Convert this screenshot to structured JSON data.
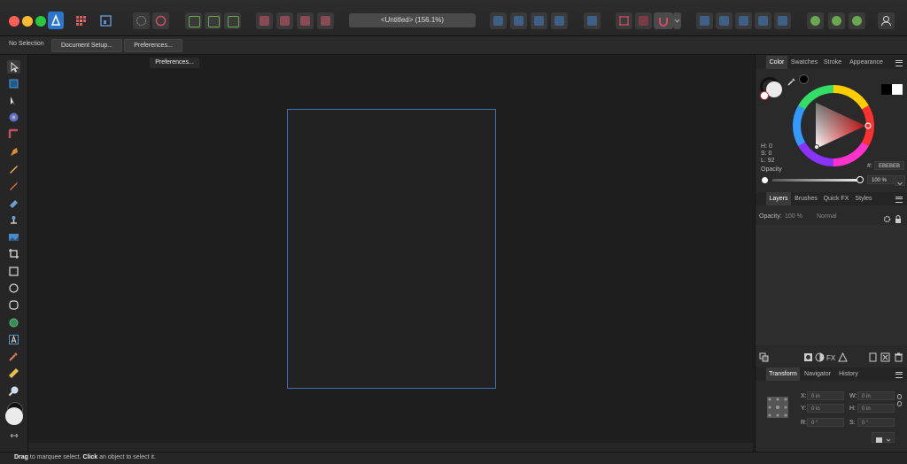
{
  "window": {
    "title": "<Untitled> (156.1%)"
  },
  "context_bar": {
    "selection_label": "No Selection",
    "document_setup_label": "Document Setup...",
    "preferences_label": "Preferences..."
  },
  "tooltip": {
    "text": "Preferences..."
  },
  "status_bar": {
    "drag_word": "Drag",
    "drag_rest": " to marquee select. ",
    "click_word": "Click",
    "click_rest": " an object to select it."
  },
  "color_panel": {
    "tabs": [
      "Color",
      "Swatches",
      "Stroke",
      "Appearance"
    ],
    "h_label": "H: 0",
    "s_label": "S: 0",
    "l_label": "L: 92",
    "hex_prefix": "#:",
    "hex_value": "EBEBEB",
    "opacity_label": "Opacity",
    "opacity_value": "100 %"
  },
  "layers_panel": {
    "tabs": [
      "Layers",
      "Brushes",
      "Quick FX",
      "Styles"
    ],
    "opacity_label": "Opacity:",
    "opacity_value": "100 %",
    "blend_mode": "Normal"
  },
  "transform_panel": {
    "tabs": [
      "Transform",
      "Navigator",
      "History"
    ],
    "x_label": "X:",
    "x_value": "0 in",
    "y_label": "Y:",
    "y_value": "0 in",
    "w_label": "W:",
    "w_value": "0 in",
    "h_label": "H:",
    "h_value": "0 in",
    "r_label": "R:",
    "r_value": "0 °",
    "s_label": "S:",
    "s_value": "0 °"
  },
  "colors": {
    "accent": "#3b6fb6",
    "close": "#fe5f57",
    "minimize": "#febc2e",
    "maximize": "#28c840",
    "fill": "#ebebeb"
  },
  "tools": [
    "move-tool-icon",
    "artboard-tool-icon",
    "node-tool-icon",
    "point-transform-icon",
    "corner-tool-icon",
    "pen-tool-icon",
    "pencil-tool-icon",
    "vector-brush-icon",
    "fill-tool-icon",
    "transparency-tool-icon",
    "place-image-icon",
    "crop-tool-icon",
    "rectangle-tool-icon",
    "ellipse-tool-icon",
    "rounded-rect-tool-icon",
    "shape-tool-icon",
    "text-tool-icon",
    "color-picker-icon",
    "measure-tool-icon",
    "zoom-tool-icon"
  ]
}
